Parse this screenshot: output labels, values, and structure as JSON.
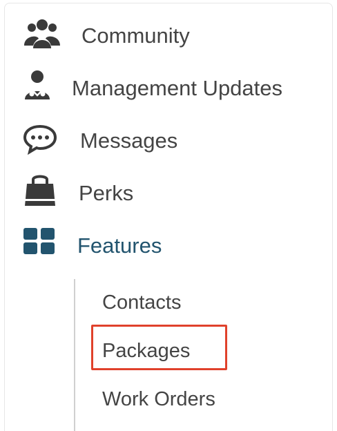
{
  "nav": {
    "items": [
      {
        "label": "Community",
        "icon": "community-icon"
      },
      {
        "label": "Management Updates",
        "icon": "manager-icon"
      },
      {
        "label": "Messages",
        "icon": "chat-bubble-icon"
      },
      {
        "label": "Perks",
        "icon": "shopping-bag-icon"
      },
      {
        "label": "Features",
        "icon": "grid-icon",
        "active": true
      }
    ],
    "submenu": [
      {
        "label": "Contacts"
      },
      {
        "label": "Packages",
        "highlighted": true
      },
      {
        "label": "Work Orders"
      }
    ]
  },
  "colors": {
    "text": "#444444",
    "active": "#22546e",
    "icon": "#3a3a3a",
    "highlight": "#e0412b",
    "submenu_line": "#cfcfcf"
  }
}
